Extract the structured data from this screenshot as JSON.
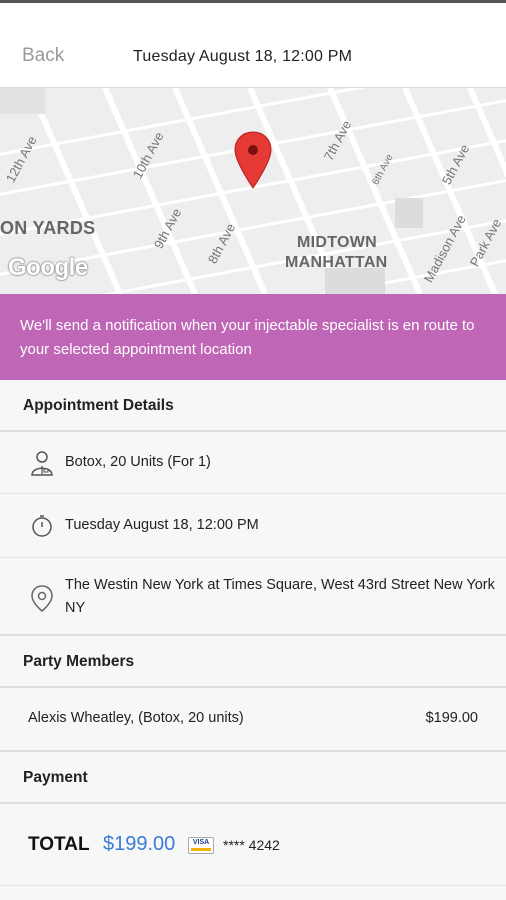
{
  "header": {
    "back_label": "Back",
    "title": "Tuesday August 18, 12:00 PM"
  },
  "map": {
    "streets": [
      "12th Ave",
      "10th Ave",
      "9th Ave",
      "8th Ave",
      "7th Ave",
      "6th Ave",
      "5th Ave",
      "Madison Ave",
      "Park Ave"
    ],
    "areas": [
      "ON YARDS",
      "MIDTOWN",
      "MANHATTAN"
    ],
    "logo": "Google",
    "pin_color": "#e53935"
  },
  "notice": {
    "text": "We'll send a notification when your injectable specialist is en route to your selected appointment location",
    "background": "#bf66b6"
  },
  "appointment": {
    "heading": "Appointment Details",
    "service": "Botox, 20 Units (For 1)",
    "datetime": "Tuesday August 18, 12:00 PM",
    "location": "The Westin New York at Times Square,  West 43rd Street New York NY"
  },
  "party": {
    "heading": "Party Members",
    "members": [
      {
        "name": "Alexis Wheatley, (Botox, 20 units)",
        "price": "$199.00"
      }
    ]
  },
  "payment": {
    "heading": "Payment",
    "total_label": "TOTAL",
    "total_amount": "$199.00",
    "card_brand": "VISA",
    "card_masked": "**** 4242",
    "accent": "#3a7bd5"
  }
}
